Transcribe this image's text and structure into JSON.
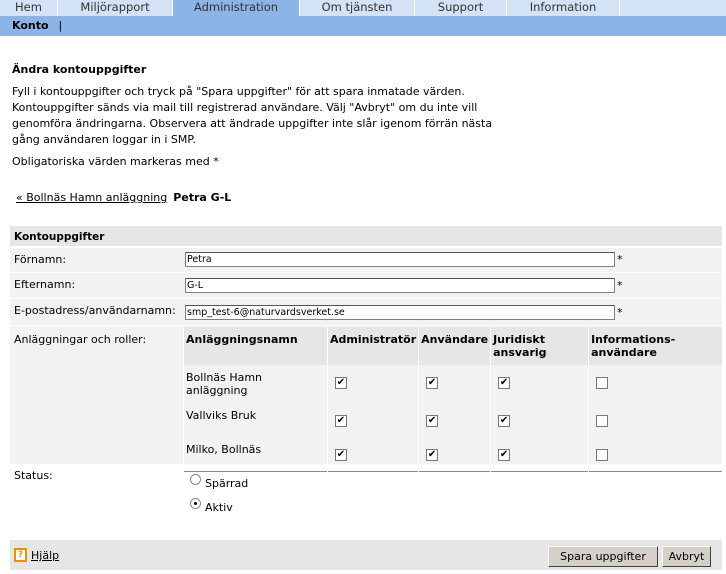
{
  "topnav": {
    "tabs": [
      {
        "label": "Hem"
      },
      {
        "label": "Miljörapport"
      },
      {
        "label": "Administration",
        "active": true
      },
      {
        "label": "Om tjänsten"
      },
      {
        "label": "Support"
      },
      {
        "label": "Information"
      }
    ]
  },
  "subnav": {
    "label": "Konto",
    "separator": "|"
  },
  "page": {
    "title": "Ändra kontouppgifter",
    "intro": "Fyll i kontouppgifter och tryck på \"Spara uppgifter\" för att spara inmatade värden. Kontouppgifter sänds via mail till registrerad användare. Välj \"Avbryt\" om du inte vill genomföra ändringarna. Observera att ändrade uppgifter inte slår igenom förrän nästa gång användaren loggar in i SMP.",
    "required_note": "Obligatoriska värden markeras med *"
  },
  "breadcrumb": {
    "link": "« Bollnäs Hamn anläggning",
    "current": "Petra G-L"
  },
  "form": {
    "section": "Kontouppgifter",
    "required_marker": "*",
    "firstname": {
      "label": "Förnamn:",
      "value": "Petra"
    },
    "lastname": {
      "label": "Efternamn:",
      "value": "G-L"
    },
    "email": {
      "label": "E-postadress/användarnamn:",
      "value": "smp_test-6@naturvardsverket.se"
    },
    "roles": {
      "label": "Anläggningar och roller:",
      "headers": [
        "Anläggningsnamn",
        "Administratör",
        "Användare",
        "Juridiskt ansvarig",
        "Informations-användare"
      ],
      "rows": [
        {
          "name": "Bollnäs Hamn anläggning",
          "checks": [
            true,
            true,
            true,
            false
          ]
        },
        {
          "name": "Vallviks Bruk",
          "checks": [
            true,
            true,
            true,
            false
          ]
        },
        {
          "name": "Milko, Bollnäs",
          "checks": [
            true,
            true,
            true,
            false
          ]
        }
      ]
    },
    "status": {
      "label": "Status:",
      "options": [
        {
          "label": "Spärrad",
          "selected": false
        },
        {
          "label": "Aktiv",
          "selected": true
        }
      ]
    }
  },
  "footer": {
    "help": "Hjälp",
    "help_icon": "?",
    "save": "Spara uppgifter",
    "cancel": "Avbryt"
  },
  "colors": {
    "nav": "#d3e2f5",
    "active": "#8db4e6",
    "help_icon": "#f28c00"
  }
}
